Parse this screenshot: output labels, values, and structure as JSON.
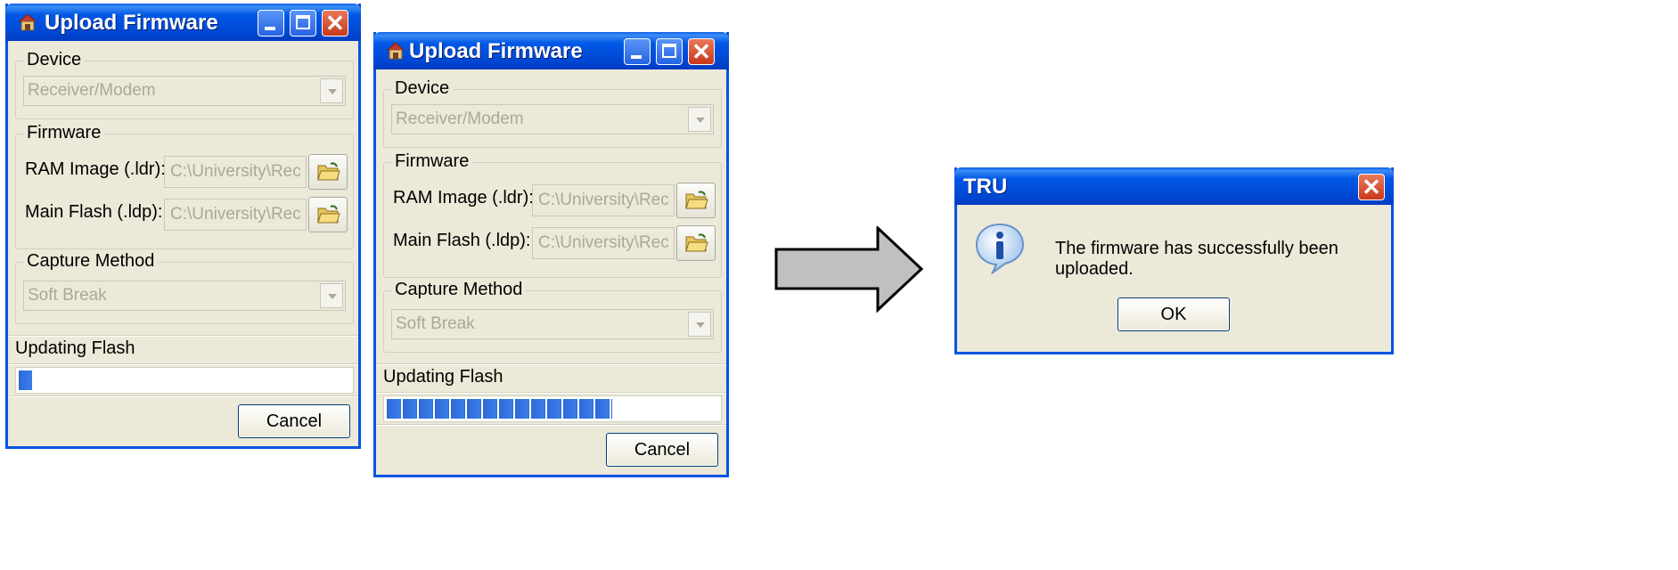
{
  "left_window": {
    "title": "Upload Firmware",
    "device_group": "Device",
    "device_value": "Receiver/Modem",
    "firmware_group": "Firmware",
    "ram_label": "RAM Image (.ldr):",
    "ram_value": "C:\\University\\Rec",
    "flash_label": "Main Flash (.ldp):",
    "flash_value": "C:\\University\\Rec",
    "capture_group": "Capture Method",
    "capture_value": "Soft Break",
    "status": "Updating Flash",
    "progress_fraction": 0.04,
    "cancel_label": "Cancel"
  },
  "middle_window": {
    "title": "Upload Firmware",
    "device_group": "Device",
    "device_value": "Receiver/Modem",
    "firmware_group": "Firmware",
    "ram_label": "RAM Image (.ldr):",
    "ram_value": "C:\\University\\Rec",
    "flash_label": "Main Flash (.ldp):",
    "flash_value": "C:\\University\\Rec",
    "capture_group": "Capture Method",
    "capture_value": "Soft Break",
    "status": "Updating Flash",
    "progress_fraction": 0.68,
    "cancel_label": "Cancel"
  },
  "dialog": {
    "title": "TRU",
    "message": "The firmware has successfully been uploaded.",
    "ok_label": "OK"
  },
  "colors": {
    "titlebar": "#0054e3",
    "window_bg": "#ece9d8",
    "progress": "#2c6ad8",
    "close_button": "#c8381a"
  },
  "icons": {
    "app": "app-icon",
    "minimize": "minimize-icon",
    "maximize": "maximize-icon",
    "close": "close-icon",
    "folder": "folder-open-icon",
    "dropdown": "chevron-down-icon",
    "info": "info-icon",
    "arrow": "arrow-right-icon"
  }
}
